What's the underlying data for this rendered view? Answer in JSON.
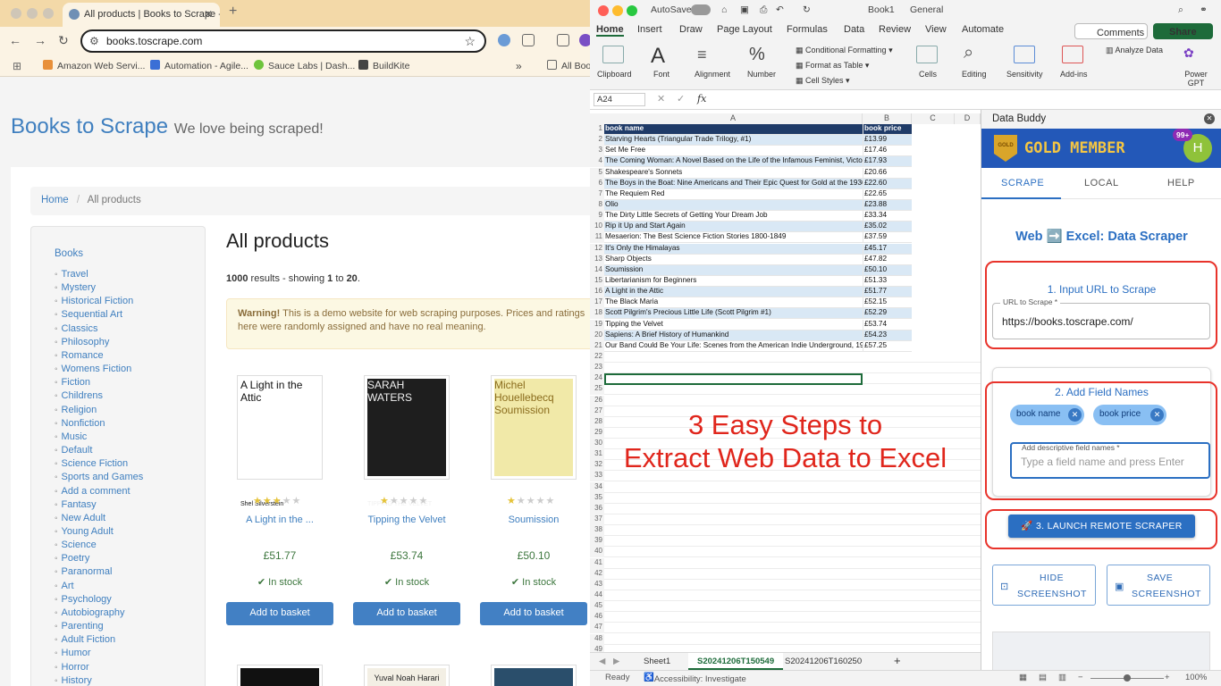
{
  "browser": {
    "tab_title": "All products | Books to Scrape - Sandbox",
    "url": "books.toscrape.com",
    "bookmarks": [
      "Amazon Web Servi...",
      "Automation - Agile...",
      "Sauce Labs | Dash...",
      "BuildKite",
      "All Bookmarks"
    ]
  },
  "site": {
    "brand": "Books to Scrape",
    "tagline": "We love being scraped!",
    "breadcrumb_home": "Home",
    "breadcrumb_current": "All products",
    "sidebar_head": "Books",
    "categories": [
      "Travel",
      "Mystery",
      "Historical Fiction",
      "Sequential Art",
      "Classics",
      "Philosophy",
      "Romance",
      "Womens Fiction",
      "Fiction",
      "Childrens",
      "Religion",
      "Nonfiction",
      "Music",
      "Default",
      "Science Fiction",
      "Sports and Games",
      "Add a comment",
      "Fantasy",
      "New Adult",
      "Young Adult",
      "Science",
      "Poetry",
      "Paranormal",
      "Art",
      "Psychology",
      "Autobiography",
      "Parenting",
      "Adult Fiction",
      "Humor",
      "Horror",
      "History"
    ],
    "heading": "All products",
    "results_total": "1000",
    "results_mid": " results - showing ",
    "results_from": "1",
    "results_to_word": " to ",
    "results_to": "20",
    "warning_strong": "Warning!",
    "warning_text": " This is a demo website for web scraping purposes. Prices and ratings here were randomly assigned and have no real meaning.",
    "stock_label": "✔ In stock",
    "basket_label": "Add to basket",
    "products": [
      {
        "title": "A Light in the ...",
        "price": "£51.77",
        "rating": 3,
        "cover_text": "A Light in the Attic",
        "cover_by": "Shel Silverstein"
      },
      {
        "title": "Tipping the Velvet",
        "price": "£53.74",
        "rating": 1,
        "cover_text": "SARAH WATERS",
        "cover_by": "TIPPING THE VELVET"
      },
      {
        "title": "Soumission",
        "price": "£50.10",
        "rating": 1,
        "cover_text": "Michel Houellebecq Soumission",
        "cover_by": ""
      }
    ],
    "next_covers": [
      "",
      "Yuval Noah Harari",
      ""
    ]
  },
  "excel": {
    "autosave": "AutoSave",
    "filename": "Book1",
    "sensitivity": "General",
    "search_icon": "search-icon",
    "menu_tabs": [
      "Home",
      "Insert",
      "Draw",
      "Page Layout",
      "Formulas",
      "Data",
      "Review",
      "View",
      "Automate"
    ],
    "comments_btn": "Comments",
    "share_btn": "Share",
    "ribbon": {
      "clipboard": "Clipboard",
      "font": "Font",
      "alignment": "Alignment",
      "number": "Number",
      "conditional": "Conditional Formatting",
      "format_table": "Format as Table",
      "cell_styles": "Cell Styles",
      "cells": "Cells",
      "editing": "Editing",
      "sensitivity": "Sensitivity",
      "addins": "Add-ins",
      "analyze": "Analyze Data",
      "powergpt": "Power GPT"
    },
    "name_box": "A24",
    "fx": "fx",
    "columns": [
      "A",
      "B",
      "C",
      "D"
    ],
    "header_a": "book name",
    "header_b": "book price",
    "rows": [
      {
        "name": "Starving Hearts (Triangular Trade Trilogy, #1)",
        "price": "£13.99"
      },
      {
        "name": "Set Me Free",
        "price": "£17.46"
      },
      {
        "name": "The Coming Woman: A Novel Based on the Life of the Infamous Feminist, Victori",
        "price": "£17.93"
      },
      {
        "name": "Shakespeare's Sonnets",
        "price": "£20.66"
      },
      {
        "name": "The Boys in the Boat: Nine Americans and Their Epic Quest for Gold at the 1936",
        "price": "£22.60"
      },
      {
        "name": "The Requiem Red",
        "price": "£22.65"
      },
      {
        "name": "Olio",
        "price": "£23.88"
      },
      {
        "name": "The Dirty Little Secrets of Getting Your Dream Job",
        "price": "£33.34"
      },
      {
        "name": "Rip it Up and Start Again",
        "price": "£35.02"
      },
      {
        "name": "Mesaerion: The Best Science Fiction Stories 1800-1849",
        "price": "£37.59"
      },
      {
        "name": "It's Only the Himalayas",
        "price": "£45.17"
      },
      {
        "name": "Sharp Objects",
        "price": "£47.82"
      },
      {
        "name": "Soumission",
        "price": "£50.10"
      },
      {
        "name": "Libertarianism for Beginners",
        "price": "£51.33"
      },
      {
        "name": "A Light in the Attic",
        "price": "£51.77"
      },
      {
        "name": "The Black Maria",
        "price": "£52.15"
      },
      {
        "name": "Scott Pilgrim's Precious Little Life (Scott Pilgrim #1)",
        "price": "£52.29"
      },
      {
        "name": "Tipping the Velvet",
        "price": "£53.74"
      },
      {
        "name": "Sapiens: A Brief History of Humankind",
        "price": "£54.23"
      },
      {
        "name": "Our Band Could Be Your Life: Scenes from the American Indie Underground, 198",
        "price": "£57.25"
      }
    ],
    "banner_line1": "3 Easy Steps to",
    "banner_line2": "Extract Web Data to Excel",
    "sheet_tabs": [
      "Sheet1",
      "S20241206T150549",
      "S20241206T160250"
    ],
    "status_ready": "Ready",
    "status_accessibility": "Accessibility: Investigate",
    "zoom": "100%"
  },
  "databuddy": {
    "title": "Data Buddy",
    "gold": "GOLD MEMBER",
    "gold_badge": "GOLD",
    "badge": "99+",
    "avatar": "H",
    "tabs": [
      "SCRAPE",
      "LOCAL",
      "HELP"
    ],
    "heading": "Web ➡️ Excel: Data Scraper",
    "step1": "1. Input URL to Scrape",
    "url_label": "URL to Scrape *",
    "url_value": "https://books.toscrape.com/",
    "step2": "2. Add Field Names",
    "chips": [
      "book name",
      "book price"
    ],
    "field_label": "Add descriptive field names *",
    "field_placeholder": "Type a field name and press Enter",
    "launch": "3. LAUNCH REMOTE SCRAPER",
    "hide_l1": "HIDE",
    "hide_l2": "SCREENSHOT",
    "save_l1": "SAVE",
    "save_l2": "SCREENSHOT",
    "colors": {
      "accent": "#2b6fc2",
      "red": "#e8332b",
      "gold": "#f5c642"
    }
  }
}
